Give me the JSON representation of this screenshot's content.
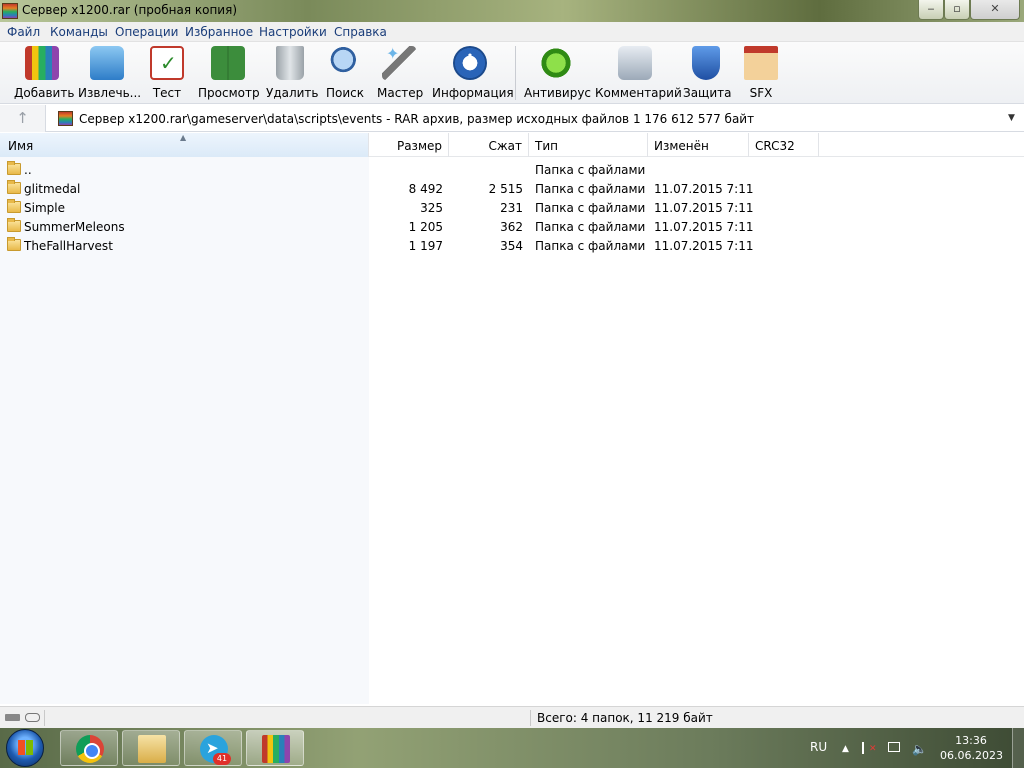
{
  "window": {
    "title": "Сервер x1200.rar (пробная копия)",
    "buttons": {
      "minimize": "‒",
      "maximize": "▫",
      "close": "✕"
    }
  },
  "menu": {
    "items": [
      "Файл",
      "Команды",
      "Операции",
      "Избранное",
      "Настройки",
      "Справка"
    ]
  },
  "toolbar": {
    "buttons": [
      {
        "label": "Добавить",
        "icon": "add-archive-icon"
      },
      {
        "label": "Извлечь...",
        "icon": "extract-icon"
      },
      {
        "label": "Тест",
        "icon": "test-icon"
      },
      {
        "label": "Просмотр",
        "icon": "view-book-icon"
      },
      {
        "label": "Удалить",
        "icon": "trash-icon"
      },
      {
        "label": "Поиск",
        "icon": "magnifier-icon"
      },
      {
        "label": "Мастер",
        "icon": "wand-icon"
      },
      {
        "label": "Информация",
        "icon": "info-icon"
      },
      {
        "label": "Антивирус",
        "icon": "antivirus-bug-icon"
      },
      {
        "label": "Комментарий",
        "icon": "comment-icon"
      },
      {
        "label": "Защита",
        "icon": "shield-icon"
      },
      {
        "label": "SFX",
        "icon": "sfx-box-icon"
      }
    ]
  },
  "address": {
    "up_icon": "↑",
    "path": "Сервер x1200.rar\\gameserver\\data\\scripts\\events - RAR архив, размер исходных файлов 1 176 612 577 байт",
    "dropdown_icon": "▼"
  },
  "filelist": {
    "sort_indicator": "▲",
    "columns": {
      "name": "Имя",
      "size": "Размер",
      "packed": "Сжат",
      "type": "Тип",
      "modified": "Изменён",
      "crc": "CRC32"
    },
    "rows": [
      {
        "name": "..",
        "size": "",
        "packed": "",
        "type": "Папка с файлами",
        "modified": ""
      },
      {
        "name": "glitmedal",
        "size": "8 492",
        "packed": "2 515",
        "type": "Папка с файлами",
        "modified": "11.07.2015 7:11"
      },
      {
        "name": "Simple",
        "size": "325",
        "packed": "231",
        "type": "Папка с файлами",
        "modified": "11.07.2015 7:11"
      },
      {
        "name": "SummerMeleons",
        "size": "1 205",
        "packed": "362",
        "type": "Папка с файлами",
        "modified": "11.07.2015 7:11"
      },
      {
        "name": "TheFallHarvest",
        "size": "1 197",
        "packed": "354",
        "type": "Папка с файлами",
        "modified": "11.07.2015 7:11"
      }
    ]
  },
  "status": {
    "text": "Всего: 4 папок, 11 219 байт"
  },
  "taskbar": {
    "apps": [
      {
        "name": "Chrome",
        "icon": "chrome-icon"
      },
      {
        "name": "Explorer",
        "icon": "file-explorer-icon"
      },
      {
        "name": "Telegram",
        "icon": "telegram-icon",
        "badge": "41"
      },
      {
        "name": "WinRAR",
        "icon": "winrar-icon",
        "active": true
      }
    ],
    "tray": {
      "language": "RU",
      "up_arrow": "▲",
      "volume_icon": "🔈",
      "time": "13:36",
      "date": "06.06.2023"
    }
  },
  "colors": {
    "menu_text": "#1a3d7a",
    "header_sorted_bg": "#dbeaf8",
    "folder": "#e8b94a",
    "telegram_badge": "#e0302a"
  }
}
